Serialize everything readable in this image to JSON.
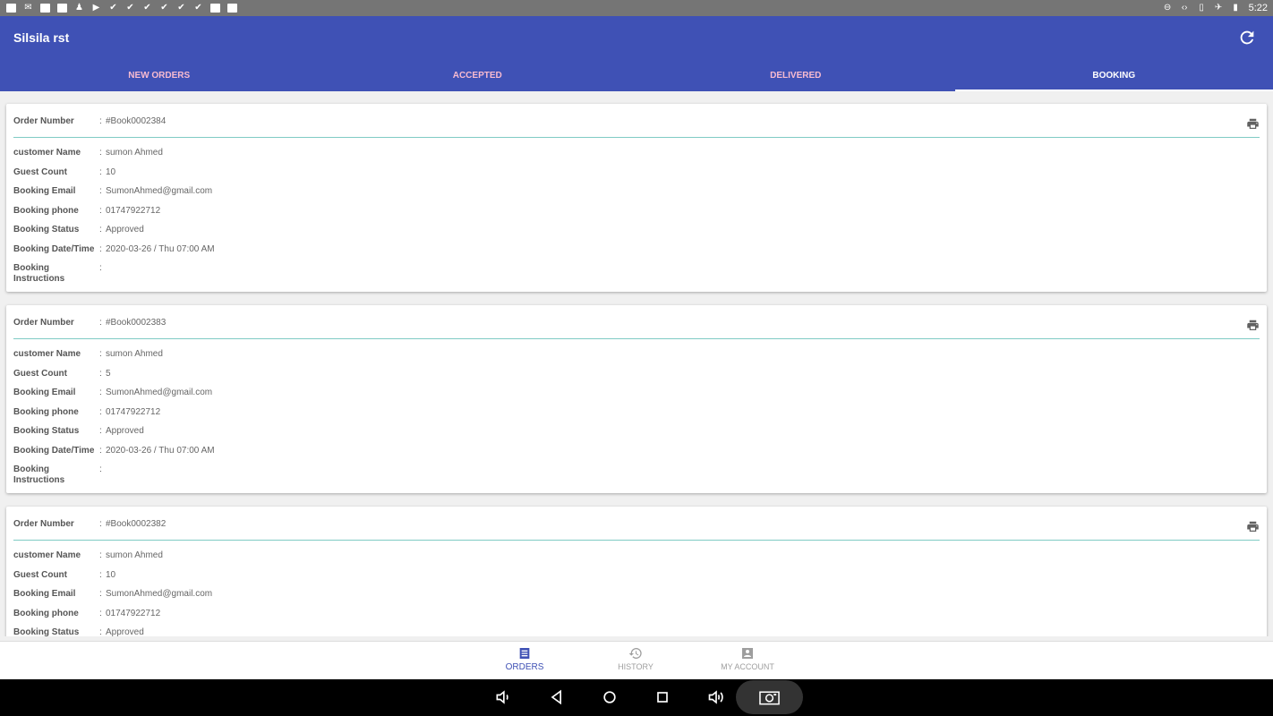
{
  "statusbar": {
    "time": "5:22"
  },
  "app": {
    "title": "Silsila rst"
  },
  "tabs": [
    {
      "label": "NEW ORDERS"
    },
    {
      "label": "ACCEPTED"
    },
    {
      "label": "DELIVERED"
    },
    {
      "label": "BOOKING"
    }
  ],
  "labels": {
    "order_number": "Order Number",
    "customer_name": "customer Name",
    "guest_count": "Guest Count",
    "booking_email": "Booking Email",
    "booking_phone": "Booking phone",
    "booking_status": "Booking Status",
    "booking_datetime": "Booking Date/Time",
    "booking_instructions": "Booking Instructions",
    "separator": ":"
  },
  "orders": [
    {
      "order_number": "#Book0002384",
      "customer_name": "sumon Ahmed",
      "guest_count": "10",
      "booking_email": "SumonAhmed@gmail.com",
      "booking_phone": "01747922712",
      "booking_status": "Approved",
      "booking_datetime": "2020-03-26 / Thu 07:00 AM",
      "booking_instructions": ""
    },
    {
      "order_number": "#Book0002383",
      "customer_name": "sumon Ahmed",
      "guest_count": "5",
      "booking_email": "SumonAhmed@gmail.com",
      "booking_phone": "01747922712",
      "booking_status": "Approved",
      "booking_datetime": "2020-03-26 / Thu 07:00 AM",
      "booking_instructions": ""
    },
    {
      "order_number": "#Book0002382",
      "customer_name": "sumon Ahmed",
      "guest_count": "10",
      "booking_email": "SumonAhmed@gmail.com",
      "booking_phone": "01747922712",
      "booking_status": "Approved"
    }
  ],
  "bottomnav": [
    {
      "label": "ORDERS",
      "icon": "list-icon"
    },
    {
      "label": "HISTORY",
      "icon": "history-icon"
    },
    {
      "label": "MY ACCOUNT",
      "icon": "account-box-icon"
    }
  ],
  "colors": {
    "primary": "#3f51b5",
    "tab_inactive": "#f8bbd0",
    "divider": "#80cbc4"
  }
}
